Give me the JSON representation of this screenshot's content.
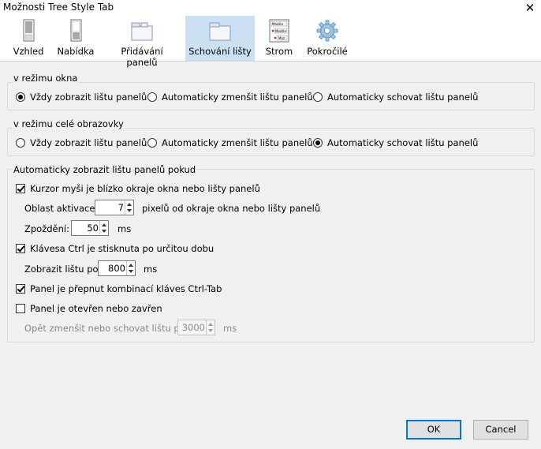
{
  "window": {
    "title": "Možnosti Tree Style Tab"
  },
  "tabs": [
    {
      "label": "Vzhled",
      "icon": "appearance-icon"
    },
    {
      "label": "Nabídka",
      "icon": "menu-icon"
    },
    {
      "label": "Přidávání panelů",
      "icon": "new-tab-icon"
    },
    {
      "label": "Schování lišty",
      "icon": "autohide-icon",
      "active": true
    },
    {
      "label": "Strom",
      "icon": "tree-icon"
    },
    {
      "label": "Pokročilé",
      "icon": "gear-icon"
    }
  ],
  "tree_icon_texts": [
    "Mozilla",
    "Mozilla",
    "Moz"
  ],
  "window_mode": {
    "legend": "v režimu okna",
    "options": [
      "Vždy zobrazit lištu panelů",
      "Automaticky zmenšit lištu panelů",
      "Automaticky schovat lištu panelů"
    ],
    "selected": 0
  },
  "fullscreen_mode": {
    "legend": "v režimu celé obrazovky",
    "options": [
      "Vždy zobrazit lištu panelů",
      "Automaticky zmenšit lištu panelů",
      "Automaticky schovat lištu panelů"
    ],
    "selected": 2
  },
  "auto_show": {
    "legend": "Automaticky zobrazit lištu panelů pokud",
    "cursor_near": {
      "label": "Kurzor myši je blízko okraje okna nebo lišty panelů",
      "checked": true
    },
    "activation_area": {
      "label": "Oblast aktivace:",
      "value": "7",
      "unit": "pixelů od okraje okna nebo lišty panelů"
    },
    "delay": {
      "label": "Zpoždění:",
      "value": "50",
      "unit": "ms"
    },
    "ctrl_key": {
      "label": "Klávesa Ctrl je stisknuta po určitou dobu",
      "checked": true
    },
    "show_after": {
      "label": "Zobrazit lištu po",
      "value": "800",
      "unit": "ms"
    },
    "ctrl_tab": {
      "label": "Panel je přepnut kombinací kláves Ctrl-Tab",
      "checked": true
    },
    "tab_open_close": {
      "label": "Panel je otevřen nebo zavřen",
      "checked": false
    },
    "hide_again": {
      "label": "Opět zmenšit nebo schovat lištu po",
      "value": "3000",
      "unit": "ms"
    }
  },
  "buttons": {
    "ok": "OK",
    "cancel": "Cancel"
  },
  "colors": {
    "active_tab": "#cce0f4",
    "default_button_border": "#0078d7",
    "dialog_bg": "#f0f0f0"
  }
}
